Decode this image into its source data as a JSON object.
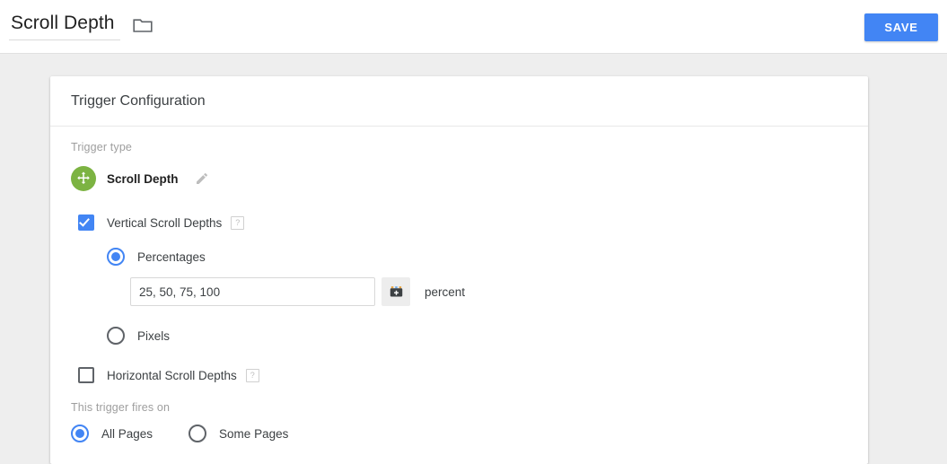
{
  "topbar": {
    "title": "Scroll Depth",
    "folder_icon": "folder-icon",
    "save_label": "SAVE",
    "accent_color": "#4285f4"
  },
  "card": {
    "header_title": "Trigger Configuration",
    "trigger_type_label": "Trigger type",
    "trigger_type": {
      "icon": "scroll-depth-move-icon",
      "icon_color": "#7cb342",
      "name": "Scroll Depth",
      "edit_icon": "pencil-icon"
    },
    "vertical": {
      "label": "Vertical Scroll Depths",
      "checked": true,
      "help": "?",
      "options": [
        {
          "label": "Percentages",
          "selected": true
        },
        {
          "label": "Pixels",
          "selected": false
        }
      ],
      "value_input": {
        "value": "25, 50, 75, 100",
        "placeholder": "",
        "variable_button_icon": "insert-variable-icon",
        "unit_label": "percent"
      }
    },
    "horizontal": {
      "label": "Horizontal Scroll Depths",
      "checked": false,
      "help": "?"
    },
    "fires_on": {
      "label": "This trigger fires on",
      "options": [
        {
          "label": "All Pages",
          "selected": true
        },
        {
          "label": "Some Pages",
          "selected": false
        }
      ]
    }
  }
}
